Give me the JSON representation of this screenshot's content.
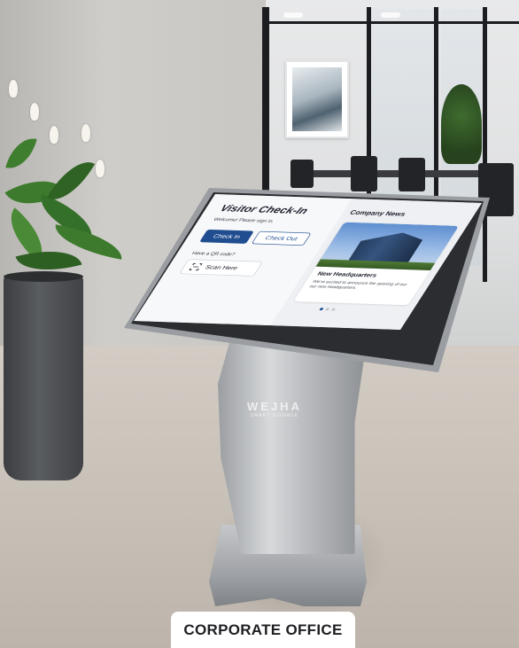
{
  "kiosk": {
    "brand_name": "WEJHA",
    "brand_tagline": "SMART SIGNAGE",
    "checkin": {
      "title": "Visitor Check-In",
      "subtitle": "Welcome! Please sign in.",
      "check_in_label": "Check In",
      "check_out_label": "Check Out",
      "qr_prompt": "Have a QR code?",
      "scan_label": "Scan Here"
    },
    "news": {
      "heading": "Company News",
      "article_title": "New Headquarters",
      "article_body": "We're excited to announce the opening of our our new headquarters.",
      "carousel_pages": 3,
      "carousel_active": 1
    }
  },
  "caption": "CORPORATE OFFICE",
  "colors": {
    "primary": "#1f4d8f",
    "caption_bg": "#ffffff"
  },
  "icons": {
    "scan": "qr-scan-icon",
    "carousel": "carousel-dot-icon"
  }
}
